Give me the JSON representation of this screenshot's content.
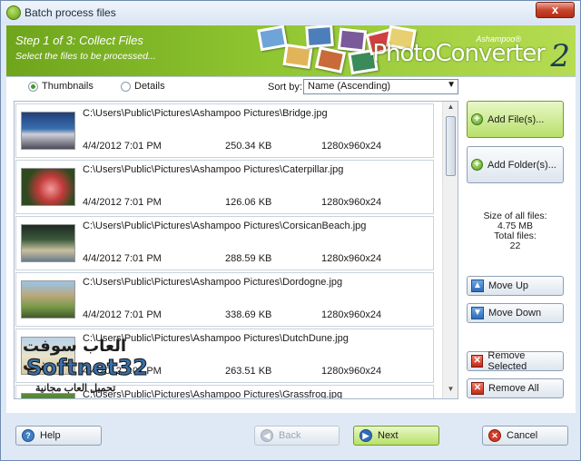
{
  "window": {
    "title": "Batch process files",
    "close_label": "x"
  },
  "banner": {
    "step_title": "Step 1 of 3: Collect Files",
    "step_subtitle": "Select the files to be processed...",
    "brand_small": "Ashampoo®",
    "brand": "PhotoConverter",
    "brand_version": "2"
  },
  "view_options": {
    "thumbnails_label": "Thumbnails",
    "details_label": "Details",
    "selected": "Thumbnails"
  },
  "sort": {
    "label": "Sort by:",
    "value": "Name (Ascending)"
  },
  "files": [
    {
      "path": "C:\\Users\\Public\\Pictures\\Ashampoo Pictures\\Bridge.jpg",
      "date": "4/4/2012 7:01 PM",
      "size": "250.34 KB",
      "dims": "1280x960x24",
      "thumb_color": "#3a6fb0"
    },
    {
      "path": "C:\\Users\\Public\\Pictures\\Ashampoo Pictures\\Caterpillar.jpg",
      "date": "4/4/2012 7:01 PM",
      "size": "126.06 KB",
      "dims": "1280x960x24",
      "thumb_color": "#c23b3b"
    },
    {
      "path": "C:\\Users\\Public\\Pictures\\Ashampoo Pictures\\CorsicanBeach.jpg",
      "date": "4/4/2012 7:01 PM",
      "size": "288.59 KB",
      "dims": "1280x960x24",
      "thumb_color": "#3c5a3c"
    },
    {
      "path": "C:\\Users\\Public\\Pictures\\Ashampoo Pictures\\Dordogne.jpg",
      "date": "4/4/2012 7:01 PM",
      "size": "338.69 KB",
      "dims": "1280x960x24",
      "thumb_color": "#7a9a4a"
    },
    {
      "path": "C:\\Users\\Public\\Pictures\\Ashampoo Pictures\\DutchDune.jpg",
      "date": "4/4/2012 7:01 PM",
      "size": "263.51 KB",
      "dims": "1280x960x24",
      "thumb_color": "#d8c9a0"
    },
    {
      "path": "C:\\Users\\Public\\Pictures\\Ashampoo Pictures\\Grassfrog.jpg",
      "date": "",
      "size": "",
      "dims": "",
      "thumb_color": "#5a8a3a"
    }
  ],
  "actions": {
    "add_files": "Add File(s)...",
    "add_folder": "Add Folder(s)...",
    "move_up": "Move Up",
    "move_down": "Move Down",
    "remove_selected": "Remove Selected",
    "remove_all": "Remove All"
  },
  "stats": {
    "size_label": "Size of all files:",
    "size_value": "4.75 MB",
    "total_label": "Total files:",
    "total_value": "22"
  },
  "footer": {
    "help": "Help",
    "back": "Back",
    "next": "Next",
    "cancel": "Cancel"
  },
  "watermark": {
    "line1": "العاب سوفت نت",
    "line2": "Softnet32",
    "line3": "تحميل العاب مجانية"
  },
  "colors": {
    "accent_green": "#8fc530",
    "frame_blue": "#dfe9f5"
  }
}
